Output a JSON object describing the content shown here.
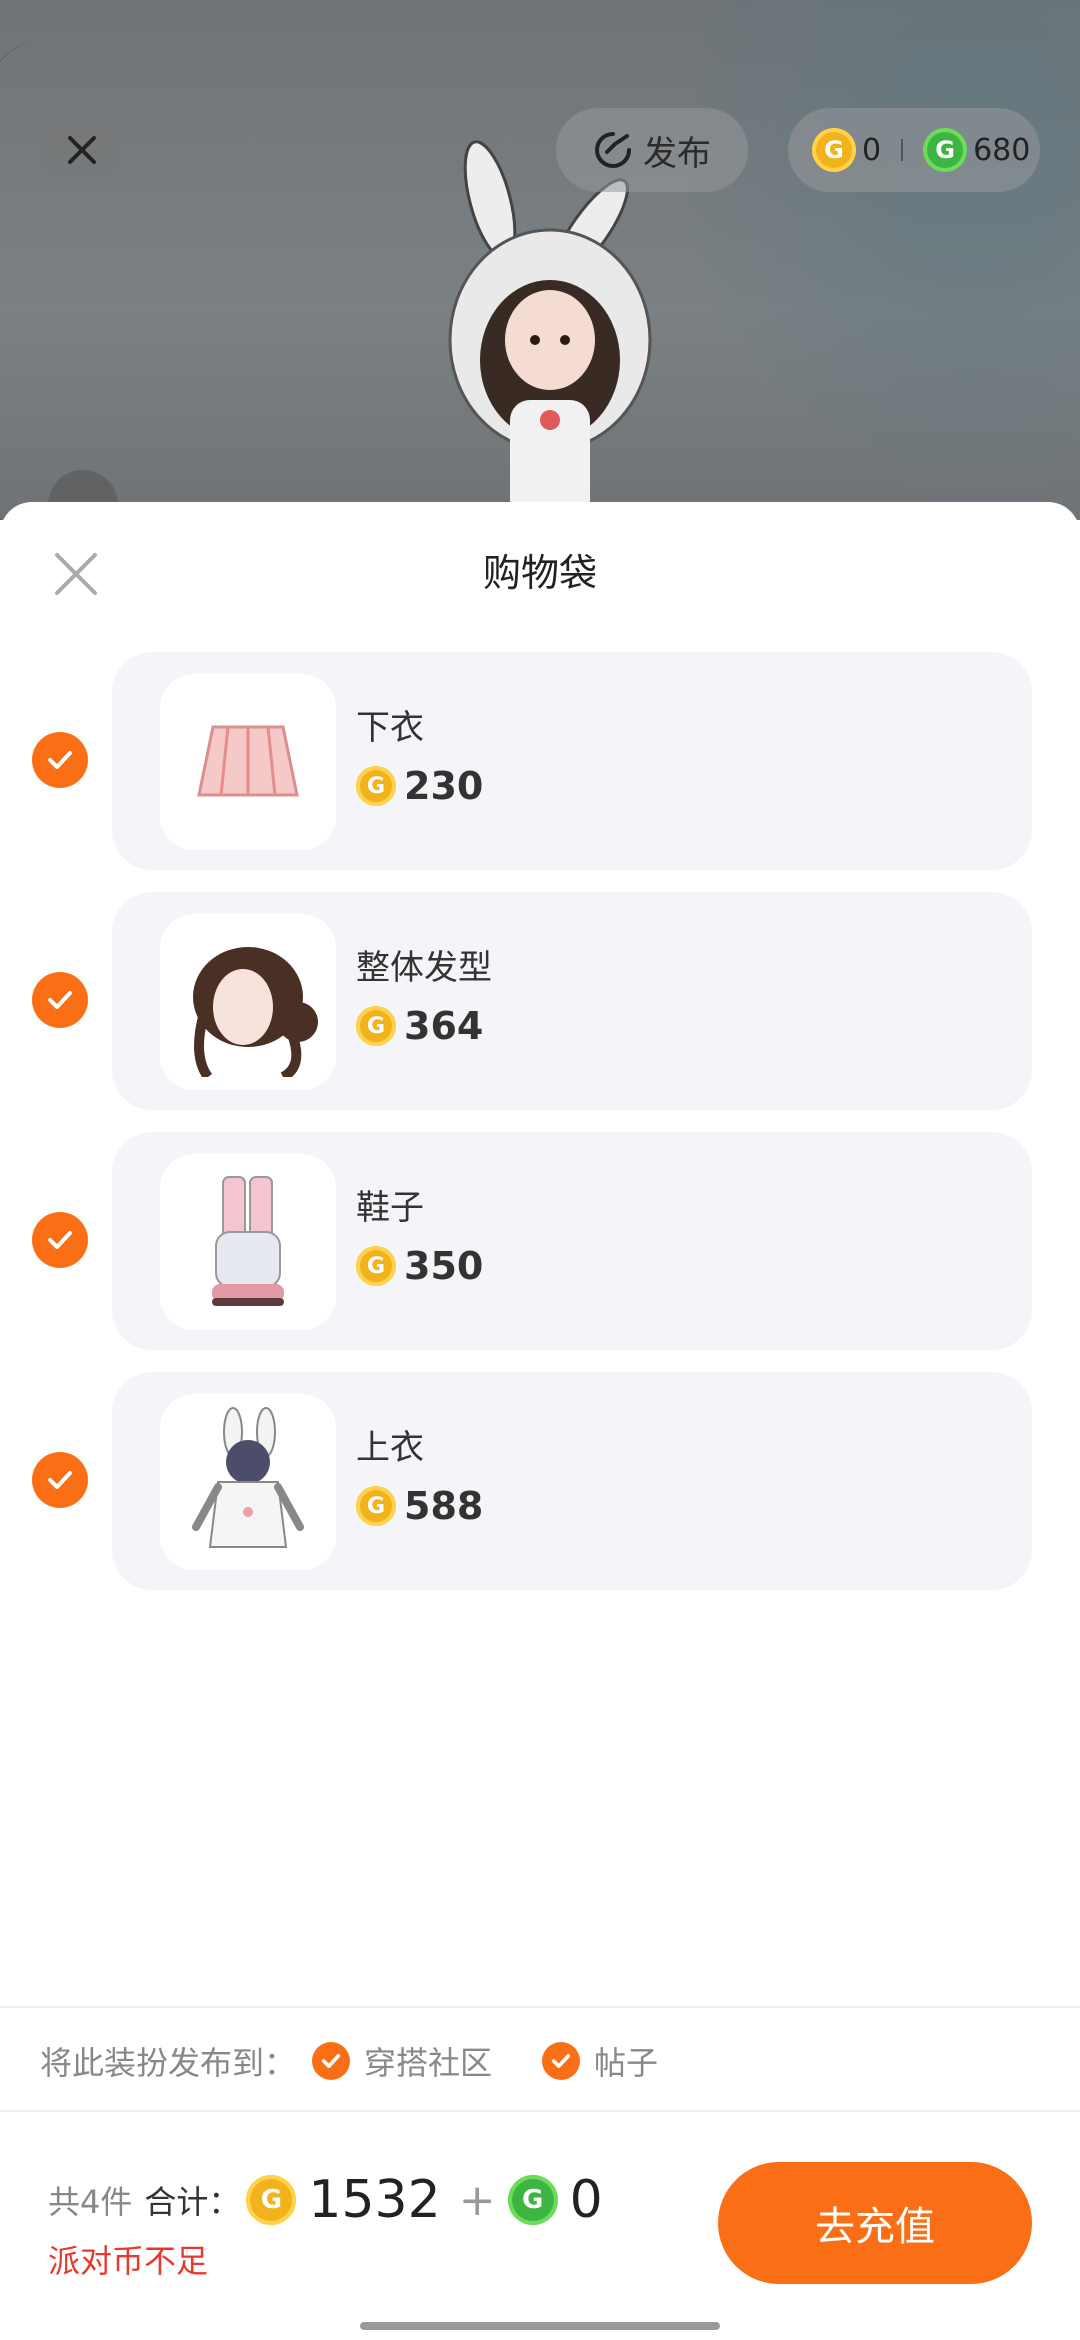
{
  "header": {
    "publish_label": "发布",
    "wallet": {
      "gold_balance": "0",
      "green_balance": "680"
    }
  },
  "sheet": {
    "title": "购物袋",
    "items": [
      {
        "name": "下衣",
        "price": "230",
        "checked": true,
        "thumb_icon": "skirt-thumb"
      },
      {
        "name": "整体发型",
        "price": "364",
        "checked": true,
        "thumb_icon": "hairstyle-thumb"
      },
      {
        "name": "鞋子",
        "price": "350",
        "checked": true,
        "thumb_icon": "shoes-thumb"
      },
      {
        "name": "上衣",
        "price": "588",
        "checked": true,
        "thumb_icon": "bunny-hoodie-thumb"
      }
    ],
    "publish_to": {
      "label": "将此装扮发布到：",
      "options": [
        {
          "label": "穿搭社区",
          "checked": true
        },
        {
          "label": "帖子",
          "checked": true
        }
      ]
    }
  },
  "footer": {
    "count_label": "共4件",
    "total_label": "合计：",
    "gold_total": "1532",
    "plus": "+",
    "green_total": "0",
    "warning": "派对币不足",
    "recharge_label": "去充值"
  },
  "colors": {
    "accent": "#fa6f16",
    "warning": "#e8392e",
    "gold_coin": "#f2b21b",
    "green_coin": "#3cb543"
  }
}
